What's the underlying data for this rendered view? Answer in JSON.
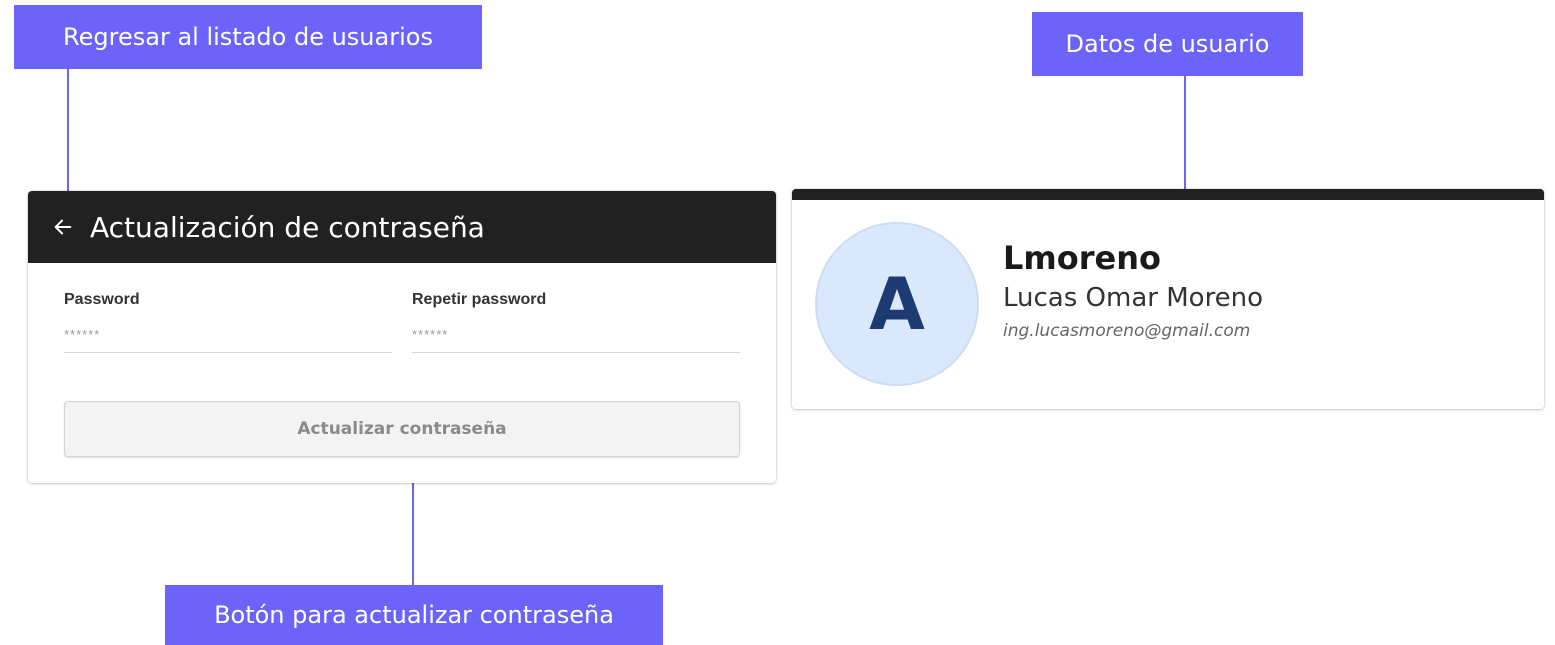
{
  "callouts": {
    "back": "Regresar al listado de usuarios",
    "user": "Datos de usuario",
    "button": "Botón para actualizar contraseña"
  },
  "password_card": {
    "title": "Actualización de contraseña",
    "back_icon": "arrow-left-icon",
    "password_label": "Password",
    "password_placeholder": "******",
    "repeat_label": "Repetir password",
    "repeat_placeholder": "******",
    "submit_label": "Actualizar contraseña"
  },
  "user_card": {
    "avatar_letter": "A",
    "username": "Lmoreno",
    "fullname": "Lucas Omar Moreno",
    "email": "ing.lucasmoreno@gmail.com"
  },
  "colors": {
    "callout": "#6b63fa",
    "header": "#212121",
    "avatar_bg": "#d9e8fc",
    "avatar_letter": "#1e3a73"
  }
}
